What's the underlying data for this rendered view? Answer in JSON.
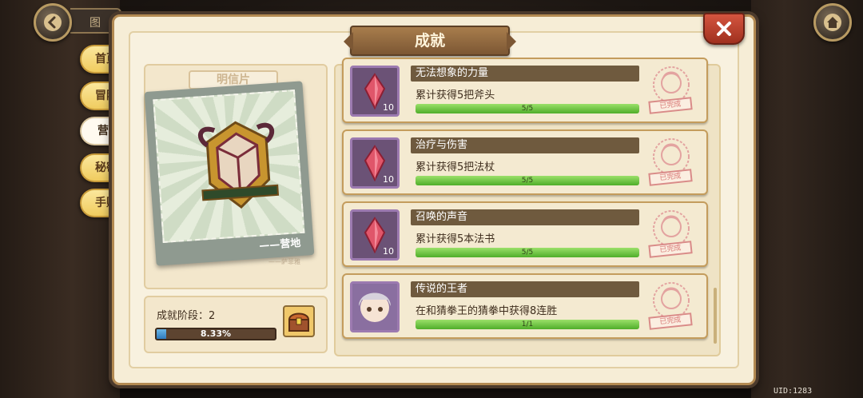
{
  "nav": {
    "top_tab_stub": "图",
    "side_tabs": [
      {
        "label": "首页"
      },
      {
        "label": "冒险"
      },
      {
        "label": "营地"
      },
      {
        "label": "秘密"
      },
      {
        "label": "手账"
      }
    ],
    "active_tab": "营地"
  },
  "dialog": {
    "title": "成就"
  },
  "postcard": {
    "label": "明信片",
    "caption": "——营地",
    "signature": "——萨菲雅"
  },
  "stage": {
    "label": "成就阶段：2",
    "progress_text": "8.33%",
    "progress_fraction": 0.0833
  },
  "achievements": [
    {
      "title": "无法想象的力量",
      "desc": "累计获得5把斧头",
      "progress": "5/5",
      "reward_count": "10",
      "fraction": 1,
      "status": "已完成",
      "icon": "red-crystal-icon"
    },
    {
      "title": "治疗与伤害",
      "desc": "累计获得5把法杖",
      "progress": "5/5",
      "reward_count": "10",
      "fraction": 1,
      "status": "已完成",
      "icon": "red-crystal-icon"
    },
    {
      "title": "召唤的声音",
      "desc": "累计获得5本法书",
      "progress": "5/5",
      "reward_count": "10",
      "fraction": 1,
      "status": "已完成",
      "icon": "red-crystal-icon"
    },
    {
      "title": "传说的王者",
      "desc": "在和猜拳王的猜拳中获得8连胜",
      "progress": "1/1",
      "reward_count": "",
      "fraction": 1,
      "status": "已完成",
      "icon": "character-portrait-icon"
    }
  ],
  "footer": {
    "uid": "UID:1283"
  },
  "colors": {
    "accent_brown": "#6f5a3e",
    "progress_green": "#4fae2a",
    "progress_blue": "#2f7bbd",
    "close_red": "#c0402d",
    "tab_yellow": "#f0cc5f"
  }
}
